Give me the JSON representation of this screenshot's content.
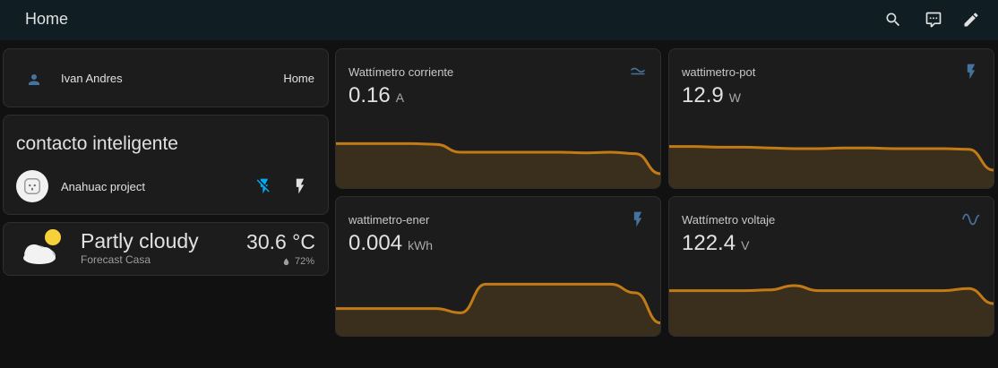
{
  "header": {
    "title": "Home",
    "icons": [
      "search-icon",
      "assist-icon",
      "pencil-icon"
    ]
  },
  "person": {
    "name": "Ivan Andres",
    "state": "Home",
    "icon": "account-icon"
  },
  "contacto": {
    "title": "contacto inteligente",
    "device_name": "Anahuac project",
    "icons": [
      "power-socket-icon",
      "flash-off-icon",
      "flash-icon"
    ]
  },
  "weather": {
    "state": "Partly cloudy",
    "name": "Forecast Casa",
    "temperature": "30.6 °C",
    "humidity": "72%",
    "icon": "partly-cloudy-icon"
  },
  "sensors": [
    {
      "name": "Wattímetro corriente",
      "value": "0.16",
      "unit": "A",
      "icon": "current-ac-icon",
      "history": [
        0.62,
        0.62,
        0.62,
        0.62,
        0.61,
        0.5,
        0.5,
        0.5,
        0.5,
        0.5,
        0.49,
        0.5,
        0.48,
        0.2
      ]
    },
    {
      "name": "wattimetro-pot",
      "value": "12.9",
      "unit": "W",
      "icon": "flash-icon",
      "history": [
        0.58,
        0.58,
        0.57,
        0.57,
        0.56,
        0.55,
        0.55,
        0.56,
        0.56,
        0.55,
        0.55,
        0.55,
        0.54,
        0.25
      ]
    },
    {
      "name": "wattimetro-ener",
      "value": "0.004",
      "unit": "kWh",
      "icon": "flash-icon",
      "history": [
        0.38,
        0.38,
        0.38,
        0.38,
        0.38,
        0.32,
        0.72,
        0.72,
        0.72,
        0.72,
        0.72,
        0.72,
        0.6,
        0.18
      ]
    },
    {
      "name": "Wattímetro voltaje",
      "value": "122.4",
      "unit": "V",
      "icon": "sine-wave-icon",
      "history": [
        0.63,
        0.63,
        0.63,
        0.63,
        0.64,
        0.7,
        0.63,
        0.63,
        0.63,
        0.63,
        0.63,
        0.63,
        0.66,
        0.45
      ]
    }
  ],
  "colors": {
    "accent": "#03a9f4",
    "icon_blue": "#44739e",
    "graph_line": "#c27a17",
    "graph_fill": "#3a2e1c"
  }
}
